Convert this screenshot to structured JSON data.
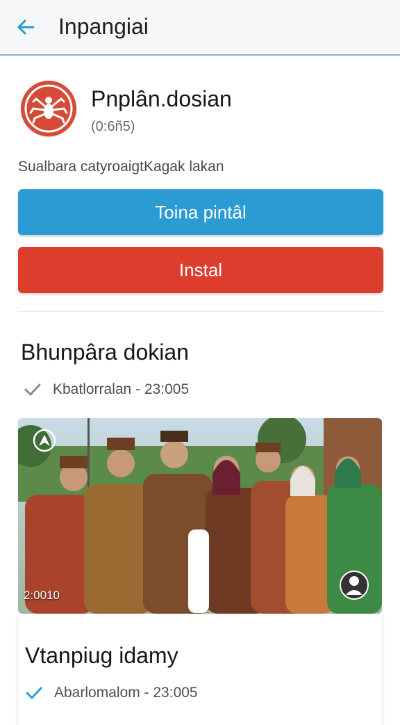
{
  "header": {
    "title": "Inpangiai",
    "back_icon": "arrow-left-icon",
    "accent": "#2b9bd4"
  },
  "app": {
    "name": "Pnplân.dosian",
    "subtitle": "(0:6ñ5)",
    "logo_icon": "spider-emblem-icon",
    "logo_color": "#d64a36",
    "description": "Sualbara catyroaigtKagak lakan"
  },
  "buttons": {
    "primary_label": "Toina pintâl",
    "primary_color": "#2b9bd4",
    "secondary_label": "Instal",
    "secondary_color": "#dd3d2c"
  },
  "section": {
    "title": "Bhunpâra dokian",
    "meta": "Kbatlorralan - 23:005",
    "meta_icon": "check-icon"
  },
  "photo": {
    "timer": "2:0010",
    "corner_icon": "compass-icon",
    "avatar_icon": "user-avatar-icon"
  },
  "card2": {
    "title": "Vtanpiug idamy",
    "meta": "Abarlomalom - 23:005",
    "meta_icon": "check-icon"
  }
}
